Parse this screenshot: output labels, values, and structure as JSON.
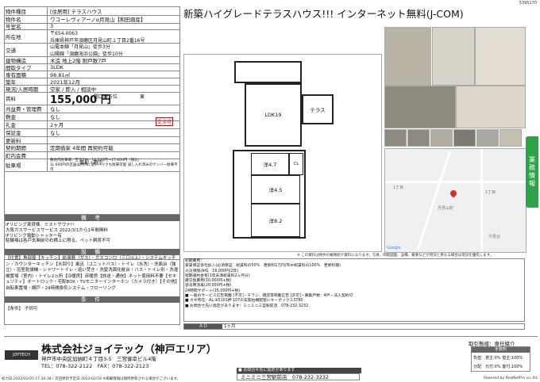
{
  "doc_id": "5395170",
  "headline": "新築ハイグレードテラスハウス!!!  インターネット無料(J-COM)",
  "table": [
    {
      "label": "物件種目",
      "value": "[住居用] テラスハウス"
    },
    {
      "label": "物件名",
      "value": "ワコーレヴィアーノα月見山【和田興産】"
    },
    {
      "label": "号室名",
      "value": "3"
    },
    {
      "label": "所在地",
      "value": "〒654-0063\n兵庫県神戸市須磨区月見山町１丁目2番16号"
    },
    {
      "label": "交通",
      "value": "山電本線「月見山」徒歩3分\n山陽線「須磨海浜公園」徒歩10分"
    },
    {
      "label": "建物構造",
      "value": "木造 地上2階 耐戸数7戸"
    },
    {
      "label": "間取タイプ",
      "value": "3LDK"
    },
    {
      "label": "専有面積",
      "value": "98.81㎡"
    },
    {
      "label": "築年",
      "value": "2021年12月"
    },
    {
      "label": "現況/入居時期",
      "value": "空家 / 即入 / 相談中"
    },
    {
      "label": "賃料",
      "value": "155,000 円"
    },
    {
      "label": "共益費・管理費",
      "value": "なし"
    },
    {
      "label": "敷金",
      "value": "なし"
    },
    {
      "label": "礼金",
      "value": "2ヶ月"
    },
    {
      "label": "保証金",
      "value": "なし"
    },
    {
      "label": "更新料",
      "value": ""
    },
    {
      "label": "契約期間",
      "value": "定期借家 4年間 再契約可能"
    },
    {
      "label": "町内会費",
      "value": ""
    },
    {
      "label": "駐車場",
      "value": "敷地内駐車場／空き7台／16,500円～17,600円（税込）\n1L 600円の区画は月内に使いバイクも駐車可能 試し入れ済みのナンバー駐車不可"
    }
  ],
  "table_extra": {
    "opening_label": "開口部方位",
    "opening_value": "東",
    "new_badge": "新着",
    "negotiable_badge": "交渉可",
    "guarantee_label": "償却・敷引"
  },
  "notes_head": "備 考",
  "notes": "IFリビング賃貸棟、ミストサウナ!!\n大阪ガスサービスサービス 2022/3/1から1年間無料\nIFリビング電動シャッター有\n駐輪場は各戸玄関前の右横上に限る。ペット飼育不可",
  "facilities_head": "設 備",
  "facilities": "【位置】角部屋【キッチン】給湯器（ガス）・ガスコンロ（三口以上）・システムキッチン・カウンターキッチン【水回り】風呂（ユニットバス）・トイレ（水洗）・洗面台（独立）・浴室乾燥機・シャワートイレ・追い焚き・洗髪洗面化粧台・バス・トイレ別・洗濯機置場（室内）・トイレ2ヵ所【冷暖房】床暖房【放送・通信】ネット使用料不要【セキュリティ】オートロック・宅配BOX・TVモニターインターホン（カメラ付き）【その他】自転車置場・網戸・24時間換気システム・フローリング",
  "conditions_head": "条 件",
  "conditions": "【条件】 子供可",
  "floorplan": {
    "ldk": "LDK19",
    "terrace": "テラス",
    "w1": "洋4.7",
    "w2": "洋4.5",
    "w3": "洋8.2",
    "cl": "CL"
  },
  "map": {
    "label_a": "1丁目",
    "label_b": "月見山町",
    "label_c": "1丁目",
    "label_d": "汐見台",
    "credit": "Google"
  },
  "map_note": "※ この資料は物件の概略紹介資料になります。写真、間取図面、設備、概要などが現況と異なる場合は現況を優先します。",
  "side_tab": "業務情報",
  "info_box": "初期費用：\n家賃保証会社加入(必須保証　総賃料の50%　更新料1万円/年or総賃料の100%　更新料無)\n火災保険(AIG　16,000円/2年)\n短期違約金有(1年未満総賃料2ヵ月分)\n鍵交換費用(10,000円+税)\n退去時消毒(20,000円+税)\n24時間サポート(15,000円+税)\n■ 一般のサービス広告掲載 [不可]・チラシ、雑誌等掲載広告 [許可]・募集戸数：4戸・法人契約可\n■ カギ所在：AL  ※5101押 107の玄関右横配管にキーボックス3780\n■ お問合せ先に指定があります：ミニミニ三宮駅前店　078-232-3232",
  "ad_label": "ＡＤ",
  "ad_value": "1ヶ月",
  "company": {
    "name": "株式会社ジョイテック（神戸エリア）",
    "address": "神戸市中央区加納町４丁目3-5　三宮御幸ビル4階",
    "tel": "TEL：078-322-2122　FAX：078-322-2123",
    "logo": "JOYTECH"
  },
  "contact": {
    "head": "■ お問合せ先に指定があります",
    "body": "ミニミニ三宮駅前店　078-232-3232"
  },
  "transaction": {
    "title": "取引態様：専任媒介",
    "fee_head": "手数料",
    "r1_label": "負担",
    "r1_value": "貸主:0%  借主:100%",
    "r2_label": "分配",
    "r2_value": "元付:0%  客付:100%"
  },
  "footer_left": "初力日:2022/02/05 17:30:38 / 次回更新予定日:2022/02/19 ※掲載情報は随時更新される場合がございます。",
  "footer_right": "Powered by RealNetPro co.,ltd."
}
